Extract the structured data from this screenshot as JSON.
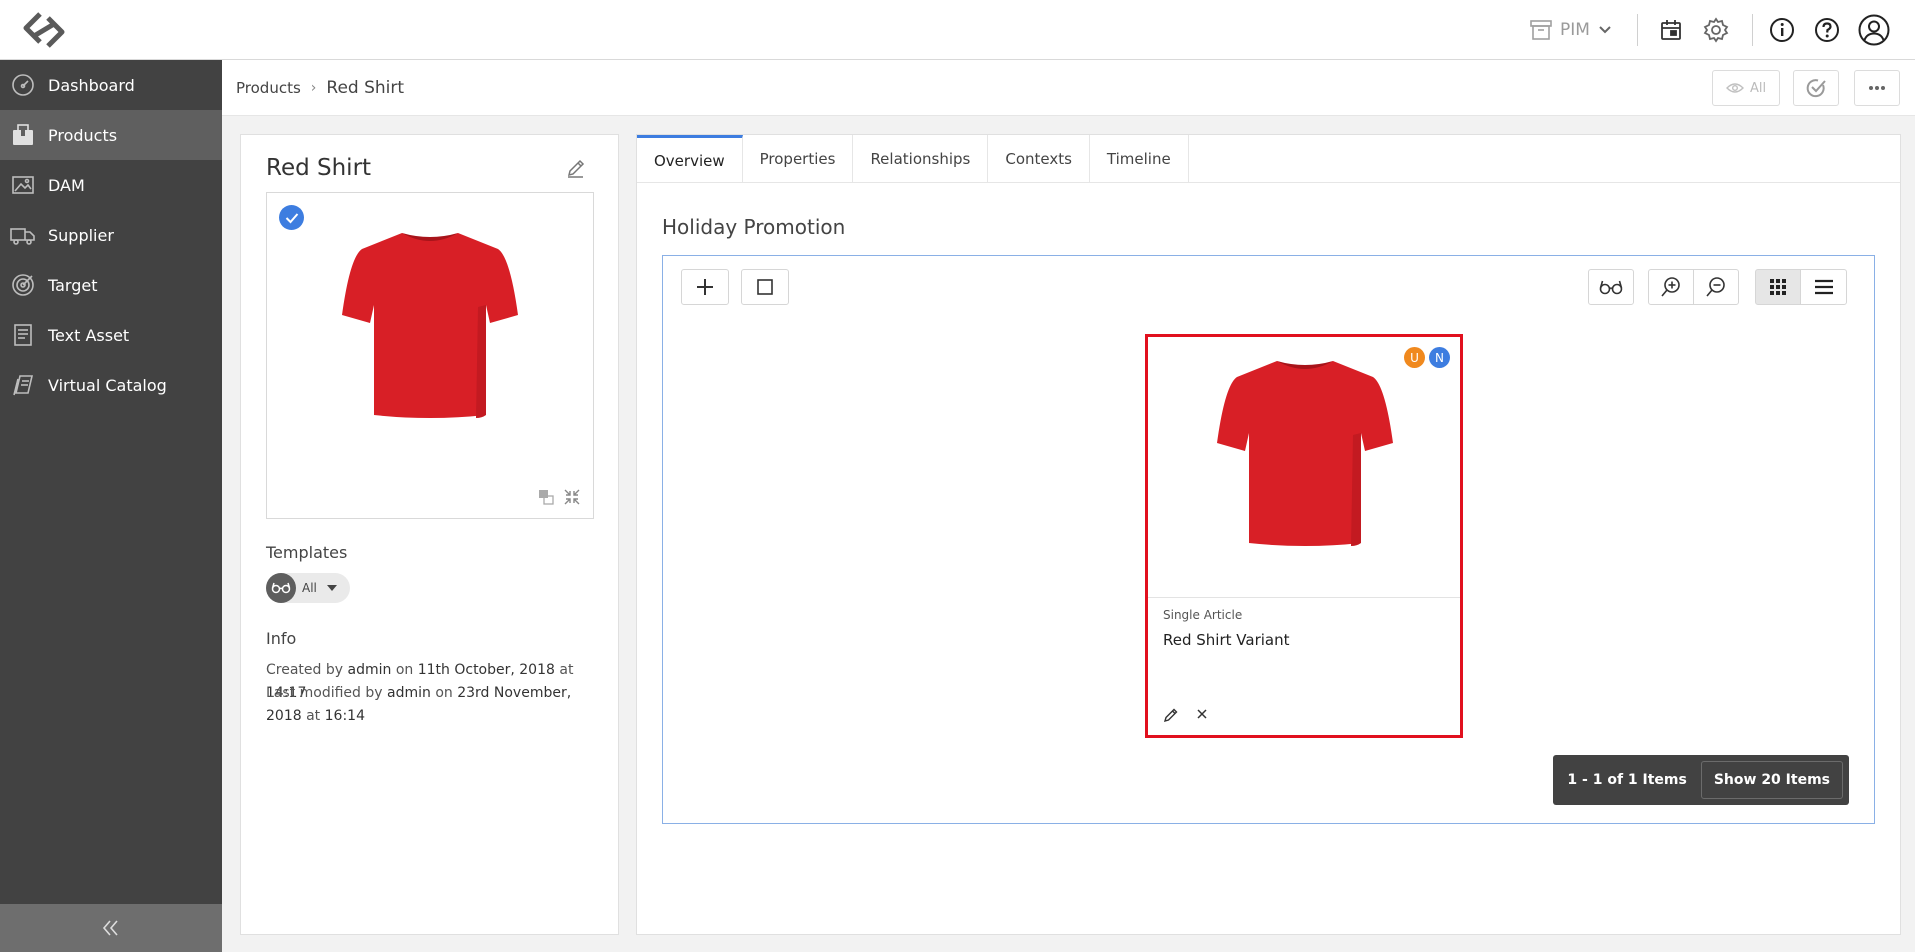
{
  "topbar": {
    "pim_label": "PIM"
  },
  "sidebar": {
    "items": [
      {
        "label": "Dashboard"
      },
      {
        "label": "Products"
      },
      {
        "label": "DAM"
      },
      {
        "label": "Supplier"
      },
      {
        "label": "Target"
      },
      {
        "label": "Text Asset"
      },
      {
        "label": "Virtual Catalog"
      }
    ],
    "active_item": "Products"
  },
  "breadcrumb": {
    "root": "Products",
    "separator": "›",
    "current": "Red Shirt"
  },
  "header_actions": {
    "view_label": "All"
  },
  "product": {
    "title": "Red Shirt",
    "templates_label": "Templates",
    "template_value": "All",
    "info_label": "Info",
    "created_prefix": "Created by",
    "created_by": "admin",
    "created_on_word": "on",
    "created_date": "11th October, 2018",
    "created_at_word": "at",
    "created_time": "14:17",
    "modified_prefix": "Last modified by",
    "modified_by": "admin",
    "modified_on_word": "on",
    "modified_date": "23rd November, 2018",
    "modified_at_word": "at",
    "modified_time": "16:14"
  },
  "tabs": [
    {
      "label": "Overview"
    },
    {
      "label": "Properties"
    },
    {
      "label": "Relationships"
    },
    {
      "label": "Contexts"
    },
    {
      "label": "Timeline"
    }
  ],
  "active_tab": "Overview",
  "section": {
    "title": "Holiday Promotion"
  },
  "card": {
    "type": "Single Article",
    "name": "Red Shirt Variant",
    "badges": [
      {
        "letter": "U",
        "color": "#f0891e"
      },
      {
        "letter": "N",
        "color": "#3d7de0"
      }
    ]
  },
  "pager": {
    "range": "1 - 1 of 1 Items",
    "show": "Show 20 Items"
  },
  "colors": {
    "accent": "#3d7de0",
    "selection_border": "#e1101e",
    "sidebar_bg": "#424242",
    "shirt": "#d81f26"
  }
}
